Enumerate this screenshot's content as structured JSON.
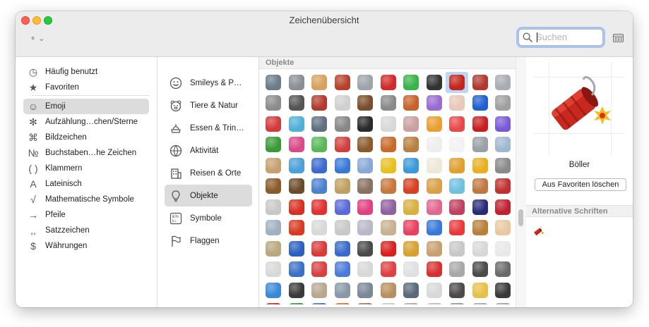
{
  "window": {
    "title": "Zeichenübersicht"
  },
  "toolbar": {
    "action_label": "⚬ ⌄"
  },
  "search": {
    "placeholder": "Suchen"
  },
  "categories": [
    {
      "label": "Häufig benutzt",
      "icon": "clock-icon",
      "glyph": "◷",
      "selected": false
    },
    {
      "label": "Favoriten",
      "icon": "star-icon",
      "glyph": "★",
      "selected": false
    },
    {
      "label": "Emoji",
      "icon": "smiley-icon",
      "glyph": "☺",
      "selected": true
    },
    {
      "label": "Aufzählung…chen/Sterne",
      "icon": "asterisk-icon",
      "glyph": "✻",
      "selected": false
    },
    {
      "label": "Bildzeichen",
      "icon": "pictograph-icon",
      "glyph": "⌘",
      "selected": false
    },
    {
      "label": "Buchstaben…he Zeichen",
      "icon": "letterlike-icon",
      "glyph": "№",
      "selected": false
    },
    {
      "label": "Klammern",
      "icon": "brackets-icon",
      "glyph": "( )",
      "selected": false
    },
    {
      "label": "Lateinisch",
      "icon": "latin-icon",
      "glyph": "A",
      "selected": false
    },
    {
      "label": "Mathematische Symbole",
      "icon": "math-icon",
      "glyph": "√",
      "selected": false
    },
    {
      "label": "Pfeile",
      "icon": "arrow-icon",
      "glyph": "→",
      "selected": false
    },
    {
      "label": "Satzzeichen",
      "icon": "punctuation-icon",
      "glyph": ",,",
      "selected": false
    },
    {
      "label": "Währungen",
      "icon": "currency-icon",
      "glyph": "$",
      "selected": false
    }
  ],
  "subcategories": [
    {
      "label": "Smileys & P…",
      "icon": "smiley-icon",
      "selected": false
    },
    {
      "label": "Tiere & Natur",
      "icon": "bear-icon",
      "selected": false
    },
    {
      "label": "Essen & Trin…",
      "icon": "food-icon",
      "selected": false
    },
    {
      "label": "Aktivität",
      "icon": "ball-icon",
      "selected": false
    },
    {
      "label": "Reisen & Orte",
      "icon": "building-icon",
      "selected": false
    },
    {
      "label": "Objekte",
      "icon": "bulb-icon",
      "selected": true
    },
    {
      "label": "Symbole",
      "icon": "symbols-icon",
      "selected": false
    },
    {
      "label": "Flaggen",
      "icon": "flag-icon",
      "selected": false
    }
  ],
  "grid": {
    "header": "Objekte",
    "selected_index": 8,
    "cells": [
      [
        "#6b7b88",
        "#8a8f96",
        "#d8a25d",
        "#b5432b",
        "#9ea4aa",
        "#d12a2a",
        "#38b44a",
        "#333333",
        "#c1271e",
        "#b03a2e",
        "#a8adb3"
      ],
      [
        "#8c8c8c",
        "#555555",
        "#b33a2e",
        "#d0d0d0",
        "#7a4e2d",
        "#8a8a8a",
        "#c8622c",
        "#9a6bd0",
        "#e8c8b8",
        "#1f5fd0",
        "#a0a0a0"
      ],
      [
        "#d33a3a",
        "#4fb0d8",
        "#607080",
        "#888888",
        "#2a2a2a",
        "#d8d8d8",
        "#caa0a0",
        "#e8a030",
        "#e84a4a",
        "#c82020",
        "#7a5ad8"
      ],
      [
        "#3a9a3a",
        "#d84a8a",
        "#58b858",
        "#d04040",
        "#8a5a2a",
        "#c86a2a",
        "#b88040",
        "#eeeeee",
        "#f2f2f2",
        "#9aa0a6",
        "#a0b8d0"
      ],
      [
        "#c8a070",
        "#4aa0d8",
        "#3a6ad0",
        "#3a78d8",
        "#88a8d8",
        "#e8c020",
        "#3a9ad8",
        "#eee8d8",
        "#e0a030",
        "#e8b020",
        "#8a8a8a"
      ],
      [
        "#8a5a2a",
        "#6a4a2a",
        "#4a80d0",
        "#c0a060",
        "#8a7060",
        "#c8783a",
        "#d84020",
        "#d8a048",
        "#70c0e0",
        "#c07840",
        "#c03030"
      ],
      [
        "#c8c8c8",
        "#d83020",
        "#e03030",
        "#5a6ad8",
        "#e04080",
        "#9060a0",
        "#d8b040",
        "#e06890",
        "#c04060",
        "#2a2a7a",
        "#c02030"
      ],
      [
        "#a0b0c0",
        "#d83a20",
        "#d8d8d8",
        "#c8c8c8",
        "#b8b8c8",
        "#c8b090",
        "#e84060",
        "#3a78d8",
        "#e83a3a",
        "#b8803a",
        "#e8c8a0"
      ],
      [
        "#b8a880",
        "#2a60c0",
        "#d83a3a",
        "#3a6ac8",
        "#4a4a4a",
        "#d82020",
        "#d8a030",
        "#c8a070",
        "#c8c8c8",
        "#d8d8d8",
        "#e8e8e8"
      ],
      [
        "#d8d8d8",
        "#3a70c8",
        "#d84040",
        "#4a7ad8",
        "#d8d8d8",
        "#e04040",
        "#e0e0e0",
        "#d83030",
        "#a8a8a8",
        "#4a4a4a",
        "#6a6a6a"
      ],
      [
        "#3a88d8",
        "#3a3a3a",
        "#b8a890",
        "#8898a8",
        "#7a8898",
        "#b89060",
        "#5a6a7a",
        "#d8d8d8",
        "#4a4a4a",
        "#e8c048",
        "#3a3a3a"
      ],
      [
        "#c03030",
        "#3a9a3a",
        "#3a78d8",
        "#e07030",
        "#9a7a5a",
        "#c8c8c8",
        "#a8a8a8",
        "#c8b8a8",
        "#8898a8",
        "#a0a8b0",
        "#98a0a8"
      ]
    ]
  },
  "preview": {
    "name": "Böller",
    "button_label": "Aus Favoriten löschen",
    "alt_header": "Alternative Schriften",
    "colors": {
      "body": "#c8281e",
      "cap": "#8a1810",
      "fuse": "#a8a8a8",
      "spark": "#f0c020"
    }
  }
}
